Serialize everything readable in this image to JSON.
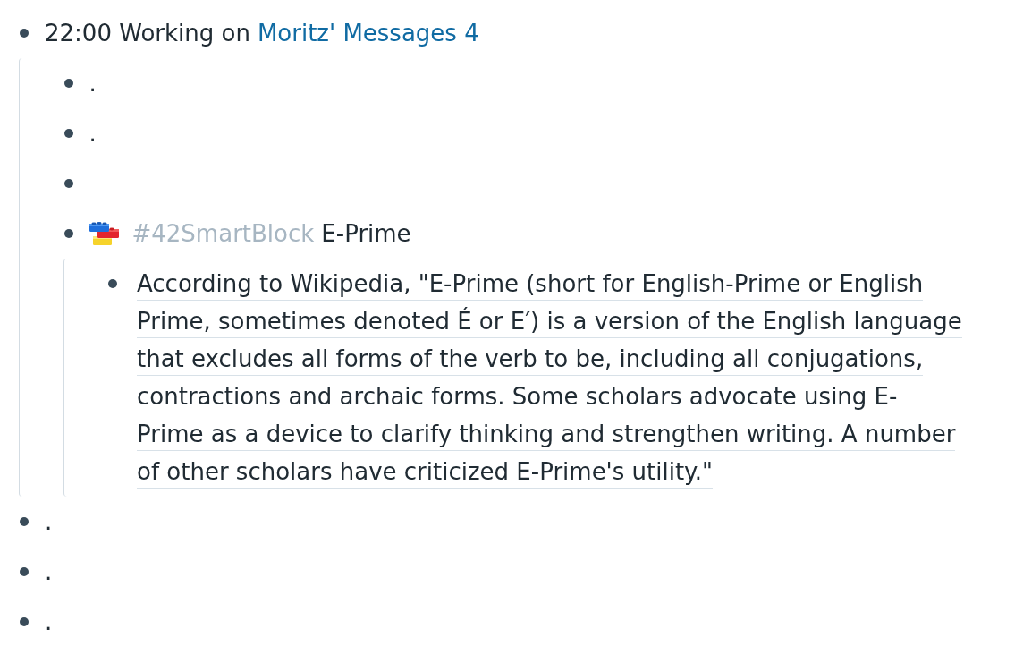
{
  "page": {
    "blocks": [
      {
        "collapsed": false,
        "segments": [
          {
            "kind": "text",
            "text": "22:00 Working on"
          },
          {
            "kind": "link",
            "text": "Moritz' Messages 4"
          }
        ],
        "children": [
          {
            "collapsed": false,
            "segments": [
              {
                "kind": "text",
                "text": "."
              }
            ]
          },
          {
            "collapsed": false,
            "segments": [
              {
                "kind": "text",
                "text": "."
              }
            ]
          },
          {
            "collapsed": false
          },
          {
            "collapsed": false,
            "segments": [
              {
                "kind": "icon"
              },
              {
                "kind": "tag",
                "text": "#42SmartBlock"
              },
              {
                "kind": "text",
                "text": "E-Prime"
              }
            ],
            "children": [
              {
                "collapsed": false,
                "segments": [
                  {
                    "kind": "underlined",
                    "text": "According to Wikipedia, \"E-Prime (short for English-Prime or English Prime, sometimes denoted É or E′) is a version of the English language that excludes all forms of the verb to be, including all conjugations, contractions and archaic forms. Some scholars advocate using E-Prime as a device to clarify thinking and strengthen writing. A number of other scholars have criticized E-Prime's utility.\""
                  }
                ]
              }
            ]
          }
        ]
      },
      {
        "collapsed": false,
        "segments": [
          {
            "kind": "text",
            "text": "."
          }
        ]
      },
      {
        "collapsed": false,
        "segments": [
          {
            "kind": "text",
            "text": "."
          }
        ]
      },
      {
        "collapsed": false,
        "segments": [
          {
            "kind": "text",
            "text": "."
          }
        ]
      }
    ]
  }
}
